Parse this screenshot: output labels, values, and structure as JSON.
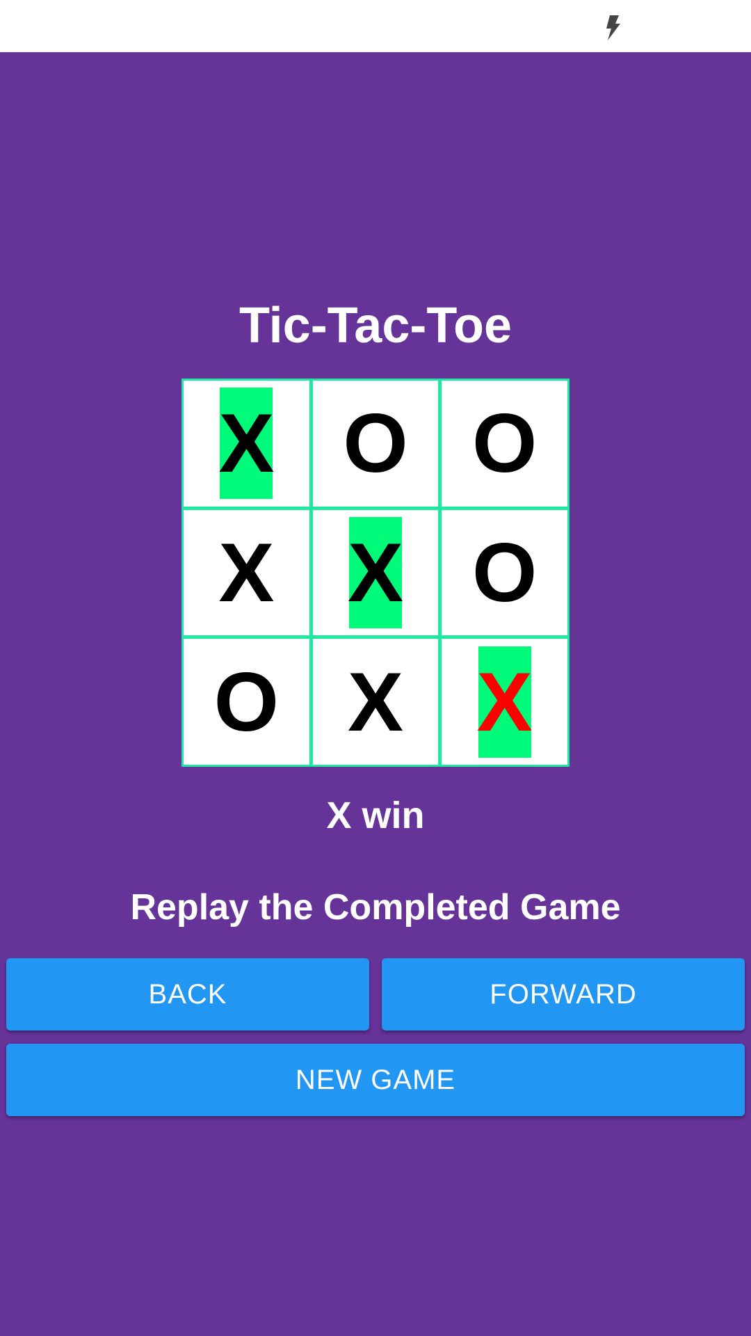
{
  "status_bar": {
    "icons": [
      "lightning-bolt-icon"
    ]
  },
  "title": "Tic-Tac-Toe",
  "board": {
    "cells": [
      {
        "mark": "X",
        "highlight": true,
        "last": false
      },
      {
        "mark": "O",
        "highlight": false,
        "last": false
      },
      {
        "mark": "O",
        "highlight": false,
        "last": false
      },
      {
        "mark": "X",
        "highlight": false,
        "last": false
      },
      {
        "mark": "X",
        "highlight": true,
        "last": false
      },
      {
        "mark": "O",
        "highlight": false,
        "last": false
      },
      {
        "mark": "O",
        "highlight": false,
        "last": false
      },
      {
        "mark": "X",
        "highlight": false,
        "last": false
      },
      {
        "mark": "X",
        "highlight": true,
        "last": true
      }
    ],
    "colors": {
      "grid": "#1de9a0",
      "highlight": "#00fa7a",
      "last_mark": "#ff0000"
    }
  },
  "result": "X win",
  "replay": {
    "title": "Replay the Completed Game",
    "back_label": "BACK",
    "forward_label": "FORWARD"
  },
  "new_game_label": "NEW GAME",
  "colors": {
    "background": "#663399",
    "button": "#2196f3"
  }
}
